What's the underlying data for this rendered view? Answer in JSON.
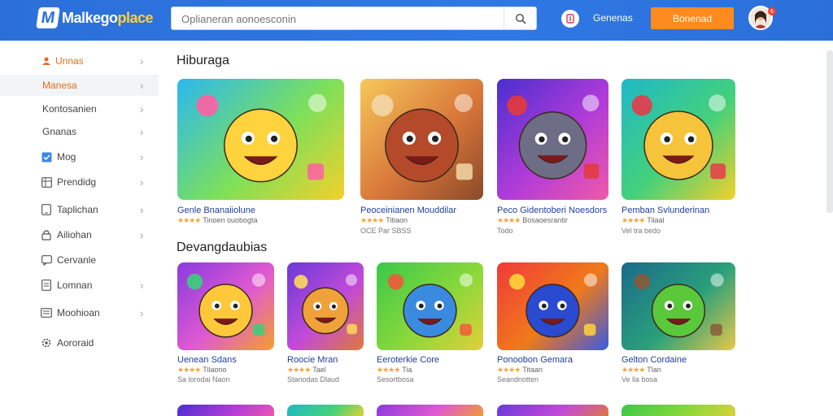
{
  "header": {
    "logo_mark": "M",
    "logo_text_main": "Malkego",
    "logo_text_accent": "place",
    "search_placeholder": "Oplianeran aonoesconin",
    "link_label": "Genenas",
    "cta_label": "Bonenad",
    "notification_count": "6"
  },
  "sidebar": {
    "items": [
      {
        "label": "Unnas",
        "icon": "user-icon",
        "has_chevron": true,
        "active": false,
        "accent": true
      },
      {
        "label": "Manesa",
        "icon": "",
        "has_chevron": true,
        "active": true,
        "accent": false
      },
      {
        "label": "Kontosanien",
        "icon": "",
        "has_chevron": true,
        "active": false,
        "accent": false
      },
      {
        "label": "Gnanas",
        "icon": "",
        "has_chevron": true,
        "active": false,
        "accent": false
      },
      {
        "label": "Mog",
        "icon": "checkbox-icon",
        "has_chevron": true,
        "active": false,
        "accent": false
      },
      {
        "label": "Prendidg",
        "icon": "grid-icon",
        "has_chevron": true,
        "active": false,
        "accent": false
      },
      {
        "label": "Taplichan",
        "icon": "tablet-icon",
        "has_chevron": true,
        "active": false,
        "accent": false
      },
      {
        "label": "Ailiohan",
        "icon": "lock-icon",
        "has_chevron": true,
        "active": false,
        "accent": false
      },
      {
        "label": "Cervanle",
        "icon": "chat-icon",
        "has_chevron": false,
        "active": false,
        "accent": false
      },
      {
        "label": "Lomnan",
        "icon": "doc-icon",
        "has_chevron": true,
        "active": false,
        "accent": false
      },
      {
        "label": "Moohioan",
        "icon": "list-icon",
        "has_chevron": true,
        "active": false,
        "accent": false
      },
      {
        "label": "Aororaid",
        "icon": "settings-icon",
        "has_chevron": false,
        "active": false,
        "accent": false
      }
    ]
  },
  "sections": [
    {
      "title": "Hiburaga",
      "cards": [
        {
          "title": "Genle Bnanaiiolune",
          "meta": "Tinoen ouobogta",
          "meta2": ""
        },
        {
          "title": "Peoceinianen Mouddilar",
          "meta": "Titiaon",
          "meta2": "OCE Par SBSS"
        },
        {
          "title": "Peco Gidentoberi Noesdors",
          "meta": "Bosaoesrantir",
          "meta2": "Todo"
        },
        {
          "title": "Pemban Svlunderinan",
          "meta": "Tilaal",
          "meta2": "Vel tra bedo"
        }
      ]
    },
    {
      "title": "Devangdaubias",
      "cards": [
        {
          "title": "Uenean Sdans",
          "meta": "Tilaono",
          "meta2": "Sa lorodai Naon"
        },
        {
          "title": "Roocie Mran",
          "meta": "Tael",
          "meta2": "Stanodas Dlaud"
        },
        {
          "title": "Eeroterkie Core",
          "meta": "Tia",
          "meta2": "Sesortbosa"
        },
        {
          "title": "Ponoobon Gemara",
          "meta": "Titaan",
          "meta2": "Seandnotten"
        },
        {
          "title": "Gelton Cordaine",
          "meta": "Tlan",
          "meta2": "Ve lla bosa"
        }
      ]
    }
  ],
  "colors": {
    "header_blue": "#2c6fd9",
    "cta_orange": "#ff8a1e",
    "title_blue": "#1f3f9a",
    "star_gold": "#f5a623"
  }
}
